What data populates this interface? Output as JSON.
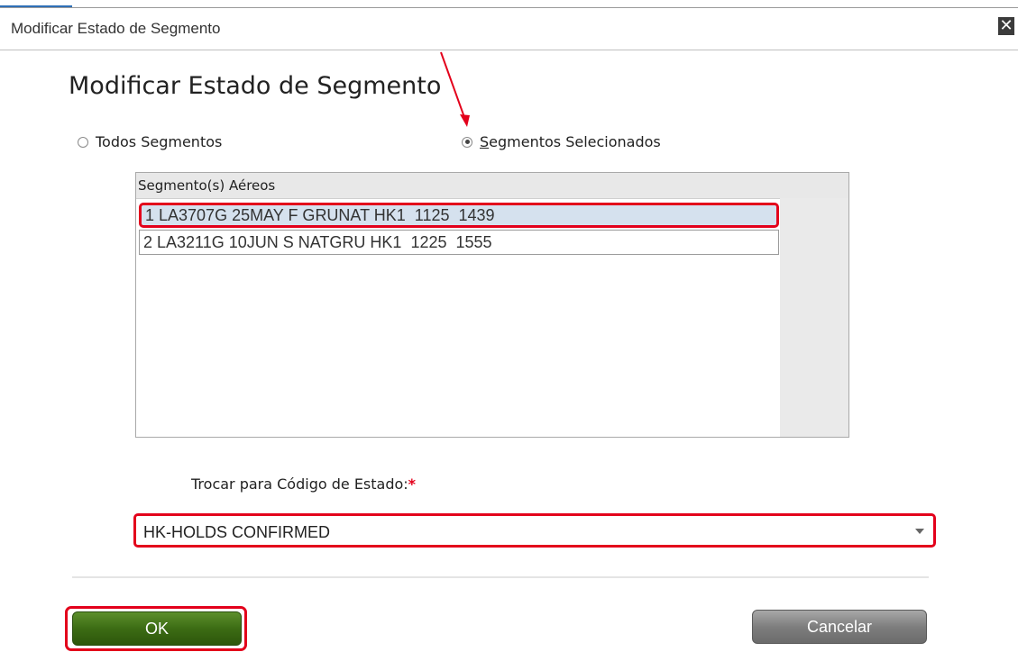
{
  "window": {
    "title": "Modificar Estado de Segmento",
    "close_glyph": "✕"
  },
  "dialog": {
    "heading": "Modificar Estado de Segmento",
    "radio_all": {
      "label": "Todos Segmentos",
      "checked": false
    },
    "radio_selected": {
      "label": "Segmentos Selecionados",
      "checked": true
    }
  },
  "segments": {
    "header": "Segmento(s) Aéreos",
    "rows": [
      {
        "text": "1 LA3707G 25MAY F GRUNAT HK1  1125  1439",
        "selected": true
      },
      {
        "text": "2 LA3211G 10JUN S NATGRU HK1  1225  1555",
        "selected": false
      }
    ]
  },
  "status": {
    "label": "Trocar para Código de Estado:",
    "required_mark": "*",
    "selected_value": "HK-HOLDS CONFIRMED"
  },
  "buttons": {
    "ok": "OK",
    "cancel": "Cancelar"
  },
  "colors": {
    "highlight": "#e3001b",
    "ok_green": "#3c6c14",
    "cancel_gray": "#7e7e7e",
    "row_selected": "#d5e1ee"
  }
}
